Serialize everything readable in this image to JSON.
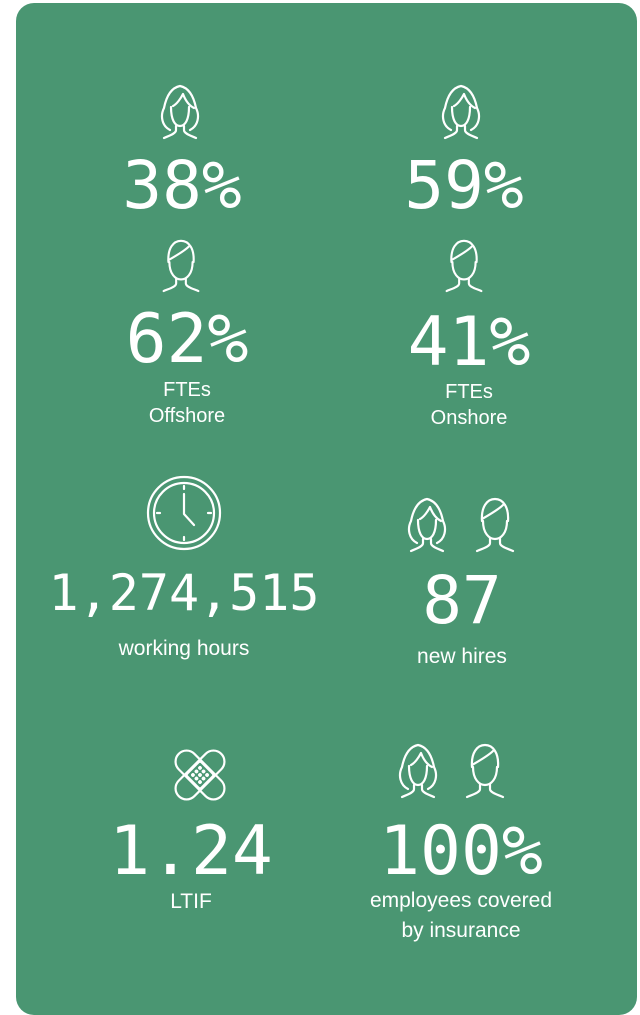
{
  "stats": {
    "women_offshore": {
      "value": "38%",
      "icon": "woman-icon"
    },
    "women_onshore": {
      "value": "59%",
      "icon": "woman-icon"
    },
    "men_offshore": {
      "value": "62%",
      "icon": "man-icon",
      "label_line1": "FTEs",
      "label_line2": "Offshore"
    },
    "men_onshore": {
      "value": "41%",
      "icon": "man-icon",
      "label_line1": "FTEs",
      "label_line2": "Onshore"
    },
    "working_hours": {
      "value": "1,274,515",
      "label": "working hours",
      "icon": "clock-icon"
    },
    "new_hires": {
      "value": "87",
      "label": "new hires",
      "icon": "people-icon"
    },
    "ltif": {
      "value": "1.24",
      "label": "LTIF",
      "icon": "bandage-icon"
    },
    "insurance": {
      "value": "100%",
      "label_line1": "employees covered",
      "label_line2": "by insurance",
      "icon": "people-icon"
    }
  },
  "colors": {
    "card_background": "#4a9672",
    "text": "#ffffff"
  }
}
